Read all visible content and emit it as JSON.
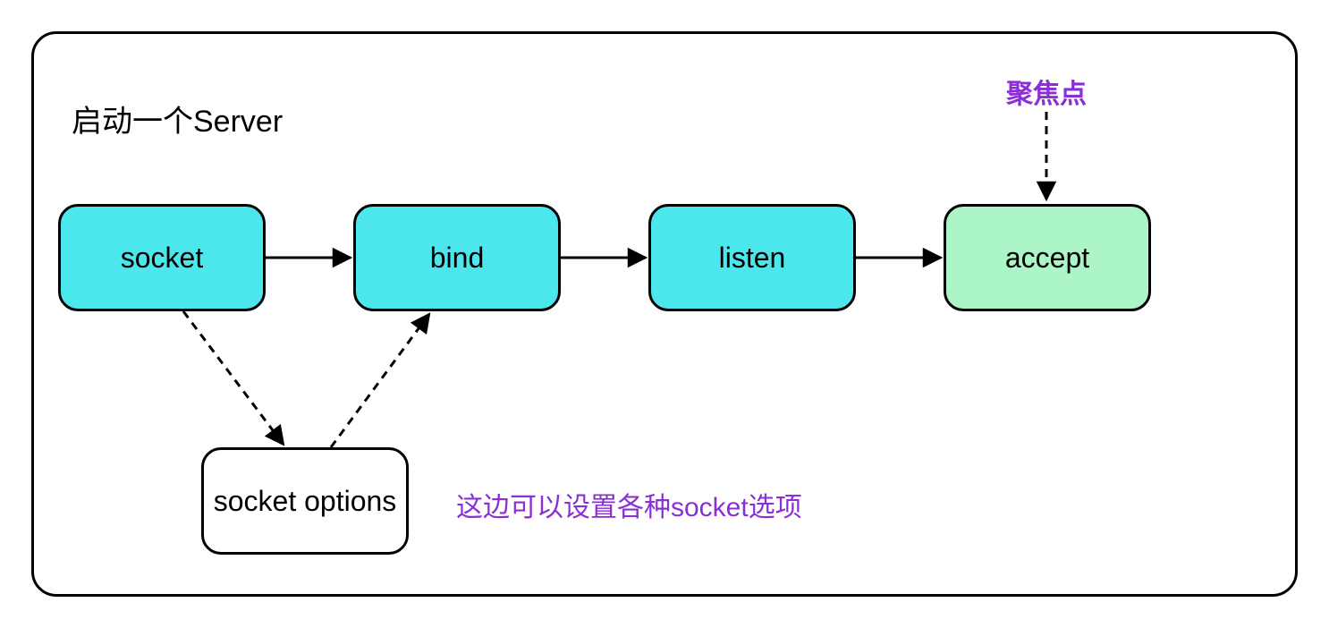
{
  "container": {
    "title": "启动一个Server"
  },
  "nodes": {
    "socket": "socket",
    "bind": "bind",
    "listen": "listen",
    "accept": "accept",
    "socket_options": "socket options"
  },
  "labels": {
    "focus_point": "聚焦点",
    "options_note": "这边可以设置各种socket选项"
  },
  "colors": {
    "cyan": "#4be7ec",
    "green": "#abf5c6",
    "purple": "#8a2fd6",
    "black": "#000000"
  }
}
